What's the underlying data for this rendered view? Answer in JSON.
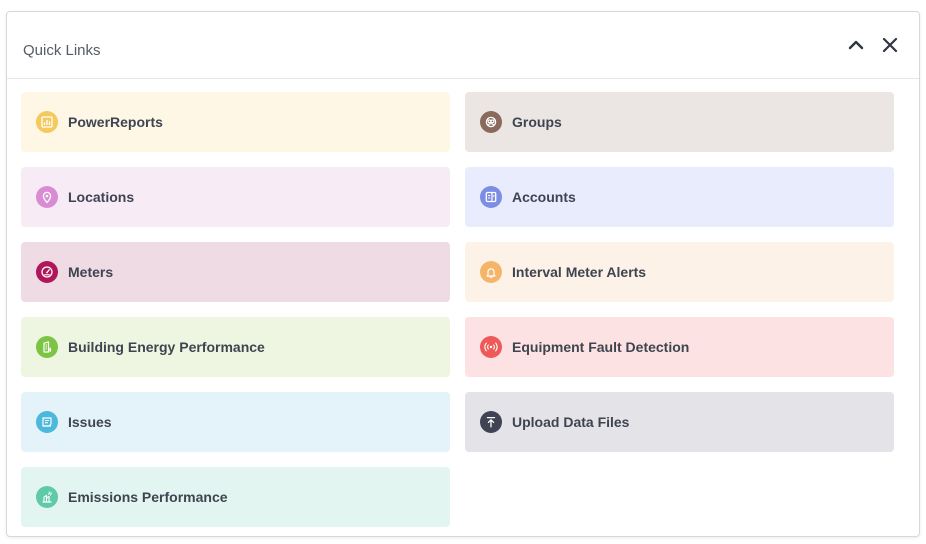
{
  "panel": {
    "title": "Quick Links"
  },
  "icons": {
    "collapse": "chevron-up-icon",
    "close": "close-icon"
  },
  "links": {
    "power_reports": {
      "label": "PowerReports",
      "icon": "report-icon",
      "bg": "#fef7e6",
      "icon_color": "#f4c95d"
    },
    "groups": {
      "label": "Groups",
      "icon": "groups-icon",
      "bg": "#ebe6e3",
      "icon_color": "#8a6a5c"
    },
    "locations": {
      "label": "Locations",
      "icon": "location-pin-icon",
      "bg": "#f7ecf6",
      "icon_color": "#d98cd4"
    },
    "accounts": {
      "label": "Accounts",
      "icon": "accounts-icon",
      "bg": "#e8ecfc",
      "icon_color": "#7e8de4"
    },
    "meters": {
      "label": "Meters",
      "icon": "meter-gauge-icon",
      "bg": "#efdbe4",
      "icon_color": "#b0165a"
    },
    "interval_meter_alerts": {
      "label": "Interval Meter Alerts",
      "icon": "bell-icon",
      "bg": "#fdf2e7",
      "icon_color": "#f4b56a"
    },
    "building_energy_performance": {
      "label": "Building Energy Performance",
      "icon": "building-energy-icon",
      "bg": "#eef6e1",
      "icon_color": "#7cc443"
    },
    "equipment_fault_detection": {
      "label": "Equipment Fault Detection",
      "icon": "signal-fault-icon",
      "bg": "#fce2e2",
      "icon_color": "#ee5a5a"
    },
    "issues": {
      "label": "Issues",
      "icon": "issues-icon",
      "bg": "#e3f3f9",
      "icon_color": "#4cb8dc"
    },
    "upload_data_files": {
      "label": "Upload Data Files",
      "icon": "upload-icon",
      "bg": "#e3e3e8",
      "icon_color": "#3f4354"
    },
    "emissions_performance": {
      "label": "Emissions Performance",
      "icon": "emissions-icon",
      "bg": "#e3f5f0",
      "icon_color": "#5fcaa8"
    }
  }
}
